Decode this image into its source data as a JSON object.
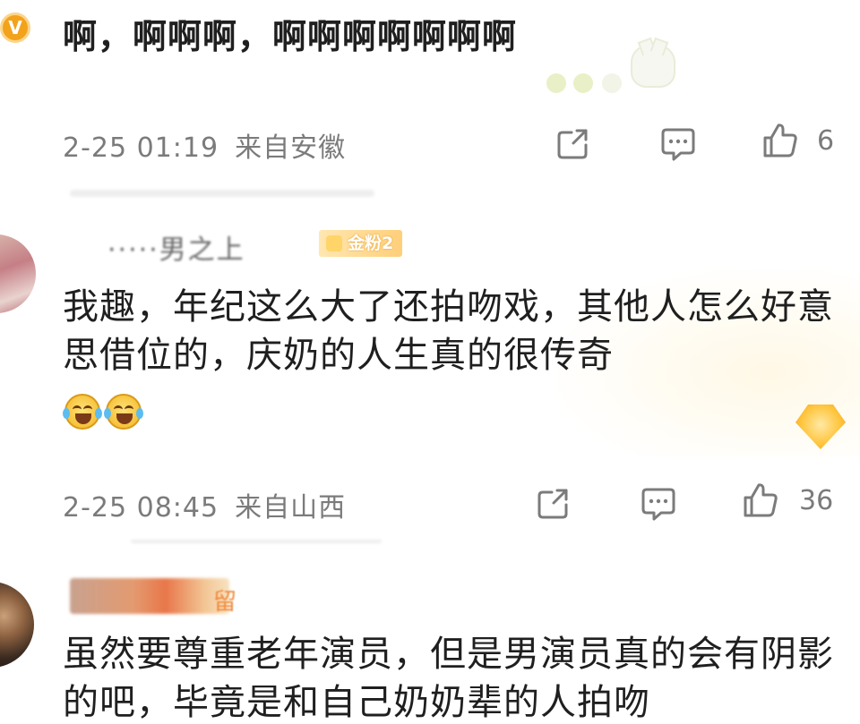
{
  "comments": [
    {
      "avatar_letter": "V",
      "text": "啊，啊啊啊，啊啊啊啊啊啊啊",
      "date": "2-25 01:19",
      "location": "来自安徽",
      "likes": "6"
    },
    {
      "username": "·····男之上",
      "fan_badge": "金粉2",
      "text": "我趣，年纪这么大了还拍吻戏，其他人怎么好意思借位的，庆奶的人生真的很传奇",
      "date": "2-25 08:45",
      "location": "来自山西",
      "likes": "36"
    },
    {
      "username_tail": "留",
      "text": "虽然要尊重老年演员，但是男演员真的会有阴影的吧，毕竟是和自己奶奶辈的人拍吻"
    }
  ],
  "icons": {
    "share": "share-icon",
    "comment": "comment-icon",
    "like": "thumbs-up-icon",
    "emoji": "laugh-cry-emoji-icon"
  },
  "colors": {
    "meta_gray": "#7b7b7b",
    "text": "#1f1f1f",
    "badge_gold": "#ffcf7a",
    "vip_orange": "#f3a21b"
  }
}
